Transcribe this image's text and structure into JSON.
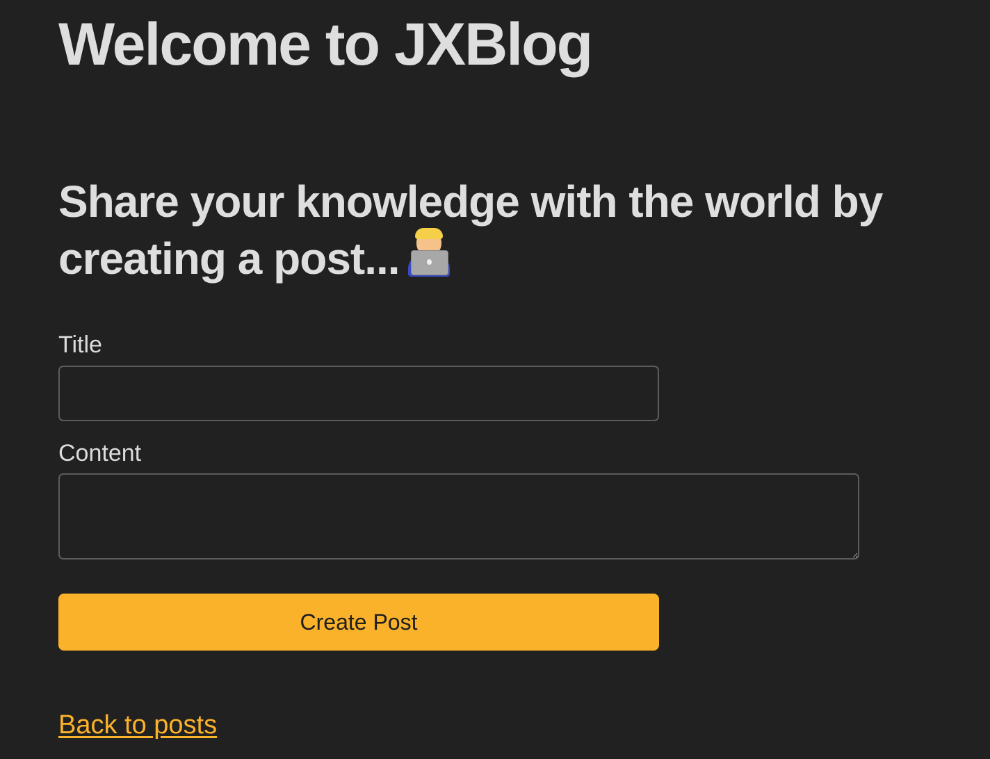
{
  "header": {
    "site_title": "Welcome to JXBlog"
  },
  "main": {
    "heading": "Share your knowledge with the world by creating a post...",
    "heading_icon": "technologist-emoji-icon"
  },
  "form": {
    "title_label": "Title",
    "title_value": "",
    "title_placeholder": "",
    "content_label": "Content",
    "content_value": "",
    "content_placeholder": "",
    "submit_label": "Create Post"
  },
  "footer": {
    "back_link": "Back to posts"
  },
  "colors": {
    "background": "#212121",
    "accent": "#fbb22b",
    "text": "#dcdcdc"
  }
}
